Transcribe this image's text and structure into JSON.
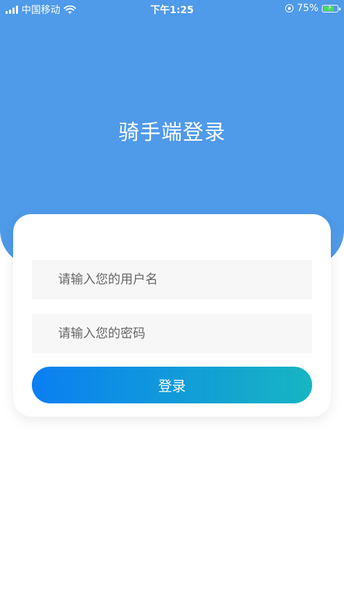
{
  "status_bar": {
    "carrier": "中国移动",
    "time": "下午1:25",
    "battery": "75%",
    "battery_level": 0.75,
    "icons": [
      "signal-icon",
      "wifi-icon",
      "rotation-lock-icon",
      "battery-icon"
    ]
  },
  "header": {
    "title": "骑手端登录",
    "bg_color": "#4f9ae9"
  },
  "form": {
    "username_placeholder": "请输入您的用户名",
    "password_placeholder": "请输入您的密码",
    "login_label": "登录"
  },
  "colors": {
    "button_start": "#0a7ff2",
    "button_end": "#17b5c2",
    "input_bg": "#f7f7f7"
  }
}
